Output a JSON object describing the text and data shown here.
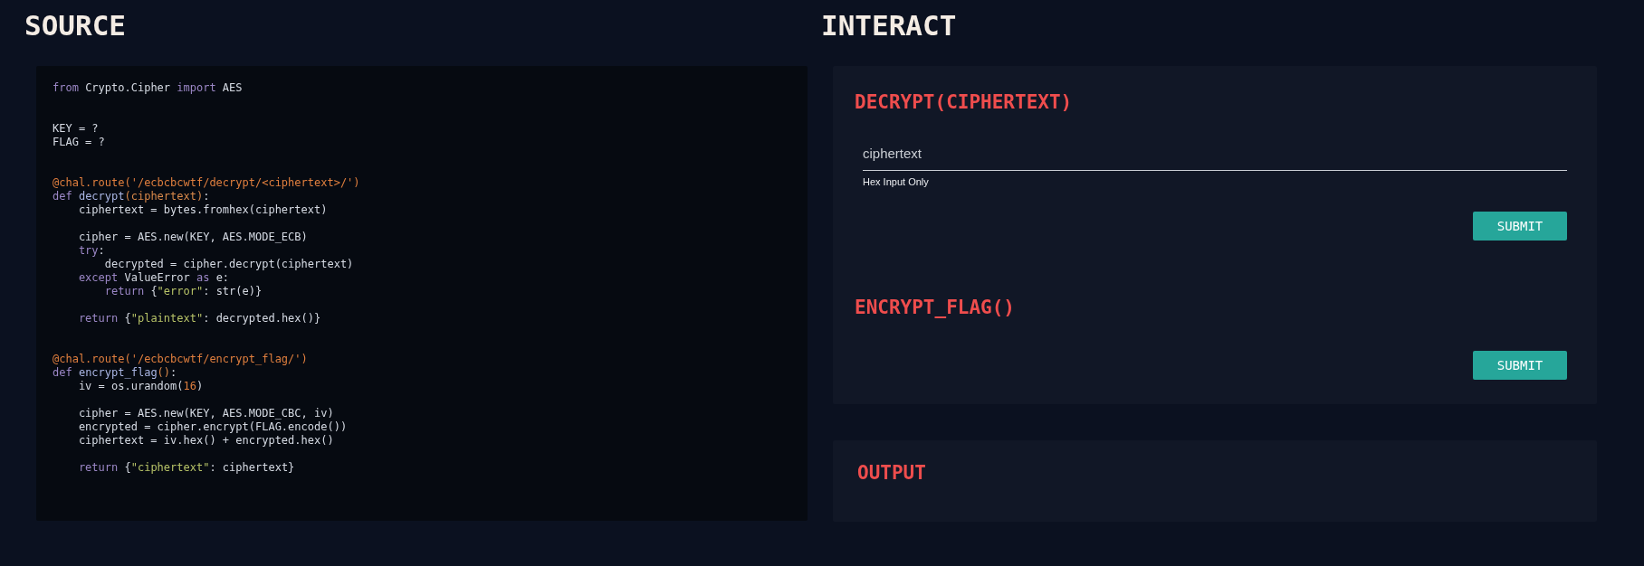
{
  "source": {
    "title": "SOURCE",
    "code_lines": [
      {
        "kind": "code",
        "tokens": [
          {
            "kind": "keyword",
            "text": "from"
          },
          {
            "kind": "plain",
            "text": " Crypto.Cipher "
          },
          {
            "kind": "keyword",
            "text": "import"
          },
          {
            "kind": "plain",
            "text": " AES"
          }
        ]
      },
      {
        "kind": "blank"
      },
      {
        "kind": "blank"
      },
      {
        "kind": "code",
        "tokens": [
          {
            "kind": "plain",
            "text": "KEY = ?"
          }
        ]
      },
      {
        "kind": "code",
        "tokens": [
          {
            "kind": "plain",
            "text": "FLAG = ?"
          }
        ]
      },
      {
        "kind": "blank"
      },
      {
        "kind": "blank"
      },
      {
        "kind": "code",
        "tokens": [
          {
            "kind": "decorator",
            "text": "@chal.route('/ecbcbcwtf/decrypt/<ciphertext>/')"
          }
        ]
      },
      {
        "kind": "code",
        "tokens": [
          {
            "kind": "keyword",
            "text": "def "
          },
          {
            "kind": "function",
            "text": "decrypt"
          },
          {
            "kind": "params",
            "text": "(ciphertext)"
          },
          {
            "kind": "plain",
            "text": ":"
          }
        ]
      },
      {
        "kind": "code",
        "tokens": [
          {
            "kind": "plain",
            "text": "    ciphertext = bytes.fromhex(ciphertext)"
          }
        ]
      },
      {
        "kind": "blank"
      },
      {
        "kind": "code",
        "tokens": [
          {
            "kind": "plain",
            "text": "    cipher = AES.new(KEY, AES.MODE_ECB)"
          }
        ]
      },
      {
        "kind": "code",
        "tokens": [
          {
            "kind": "keyword",
            "text": "    try"
          },
          {
            "kind": "plain",
            "text": ":"
          }
        ]
      },
      {
        "kind": "code",
        "tokens": [
          {
            "kind": "plain",
            "text": "        decrypted = cipher.decrypt(ciphertext)"
          }
        ]
      },
      {
        "kind": "code",
        "tokens": [
          {
            "kind": "keyword",
            "text": "    except"
          },
          {
            "kind": "plain",
            "text": " ValueError "
          },
          {
            "kind": "keyword",
            "text": "as"
          },
          {
            "kind": "plain",
            "text": " e:"
          }
        ]
      },
      {
        "kind": "code",
        "tokens": [
          {
            "kind": "keyword",
            "text": "        return"
          },
          {
            "kind": "plain",
            "text": " {"
          },
          {
            "kind": "string",
            "text": "\"error\""
          },
          {
            "kind": "plain",
            "text": ": str(e)}"
          }
        ]
      },
      {
        "kind": "blank"
      },
      {
        "kind": "code",
        "tokens": [
          {
            "kind": "keyword",
            "text": "    return"
          },
          {
            "kind": "plain",
            "text": " {"
          },
          {
            "kind": "string",
            "text": "\"plaintext\""
          },
          {
            "kind": "plain",
            "text": ": decrypted.hex()}"
          }
        ]
      },
      {
        "kind": "blank"
      },
      {
        "kind": "blank"
      },
      {
        "kind": "code",
        "tokens": [
          {
            "kind": "decorator",
            "text": "@chal.route('/ecbcbcwtf/encrypt_flag/')"
          }
        ]
      },
      {
        "kind": "code",
        "tokens": [
          {
            "kind": "keyword",
            "text": "def "
          },
          {
            "kind": "function",
            "text": "encrypt_flag"
          },
          {
            "kind": "params",
            "text": "()"
          },
          {
            "kind": "plain",
            "text": ":"
          }
        ]
      },
      {
        "kind": "code",
        "tokens": [
          {
            "kind": "plain",
            "text": "    iv = os.urandom("
          },
          {
            "kind": "number",
            "text": "16"
          },
          {
            "kind": "plain",
            "text": ")"
          }
        ]
      },
      {
        "kind": "blank"
      },
      {
        "kind": "code",
        "tokens": [
          {
            "kind": "plain",
            "text": "    cipher = AES.new(KEY, AES.MODE_CBC, iv)"
          }
        ]
      },
      {
        "kind": "code",
        "tokens": [
          {
            "kind": "plain",
            "text": "    encrypted = cipher.encrypt(FLAG.encode())"
          }
        ]
      },
      {
        "kind": "code",
        "tokens": [
          {
            "kind": "plain",
            "text": "    ciphertext = iv.hex() + encrypted.hex()"
          }
        ]
      },
      {
        "kind": "blank"
      },
      {
        "kind": "code",
        "tokens": [
          {
            "kind": "keyword",
            "text": "    return"
          },
          {
            "kind": "plain",
            "text": " {"
          },
          {
            "kind": "string",
            "text": "\"ciphertext\""
          },
          {
            "kind": "plain",
            "text": ": ciphertext}"
          }
        ]
      }
    ]
  },
  "interact": {
    "title": "INTERACT",
    "actions": [
      {
        "title": "DECRYPT(CIPHERTEXT)",
        "input": {
          "placeholder": "ciphertext",
          "helper": "Hex Input Only"
        },
        "button": "SUBMIT"
      },
      {
        "title": "ENCRYPT_FLAG()",
        "button": "SUBMIT"
      }
    ],
    "output": {
      "title": "OUTPUT"
    }
  }
}
